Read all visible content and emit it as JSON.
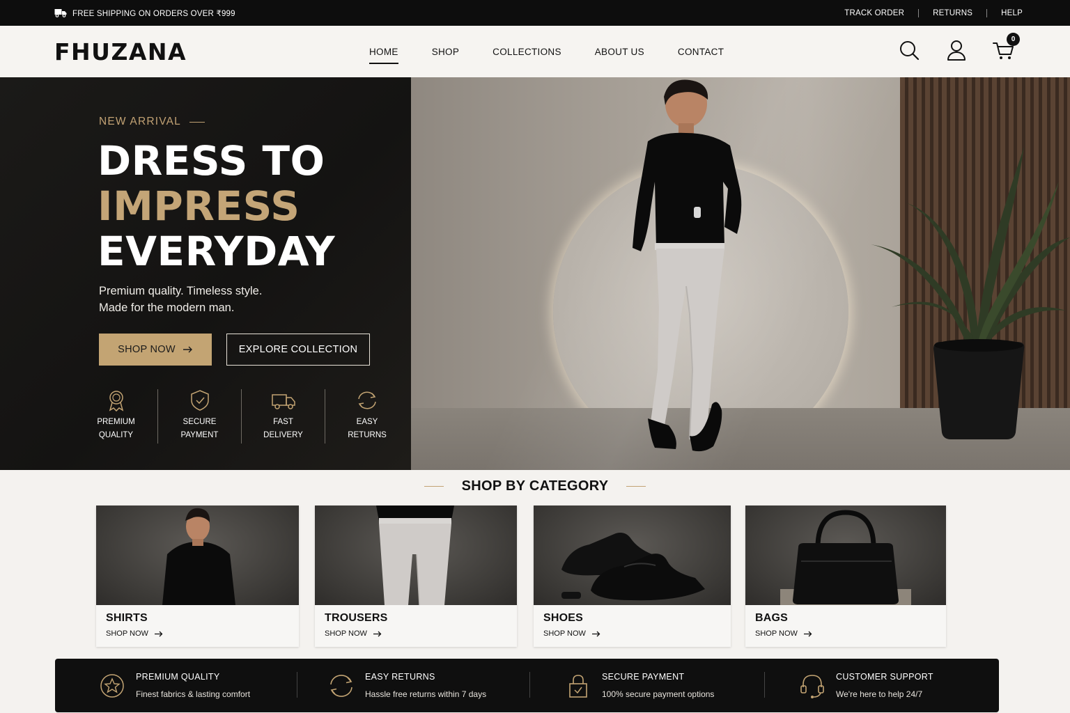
{
  "topbar": {
    "shipping_text": "FREE SHIPPING ON ORDERS OVER ₹999",
    "links": [
      "TRACK ORDER",
      "RETURNS",
      "HELP"
    ]
  },
  "header": {
    "logo": "FHUZANA",
    "nav": [
      "HOME",
      "SHOP",
      "COLLECTIONS",
      "ABOUT US",
      "CONTACT"
    ],
    "active_nav": "HOME",
    "cart_count": "0",
    "icons": [
      "search-icon",
      "user-icon",
      "cart-icon"
    ]
  },
  "hero": {
    "eyebrow": "NEW ARRIVAL",
    "headline_1": "DRESS TO",
    "headline_2": "IMPRESS",
    "headline_3": "EVERYDAY",
    "sub_1": "Premium quality. Timeless style.",
    "sub_2": "Made for the modern man.",
    "primary_button": "SHOP NOW",
    "secondary_button": "EXPLORE COLLECTION",
    "features": [
      {
        "line1": "PREMIUM",
        "line2": "QUALITY",
        "icon": "award-icon"
      },
      {
        "line1": "SECURE",
        "line2": "PAYMENT",
        "icon": "shield-check-icon"
      },
      {
        "line1": "FAST",
        "line2": "DELIVERY",
        "icon": "truck-icon"
      },
      {
        "line1": "EASY",
        "line2": "RETURNS",
        "icon": "refresh-icon"
      }
    ]
  },
  "categories": {
    "heading": "SHOP BY CATEGORY",
    "items": [
      {
        "title": "SHIRTS",
        "cta": "SHOP NOW"
      },
      {
        "title": "TROUSERS",
        "cta": "SHOP NOW"
      },
      {
        "title": "SHOES",
        "cta": "SHOP NOW"
      },
      {
        "title": "BAGS",
        "cta": "SHOP NOW"
      }
    ]
  },
  "benefits": [
    {
      "title": "PREMIUM QUALITY",
      "desc": "Finest fabrics & lasting comfort",
      "icon": "star-badge-icon"
    },
    {
      "title": "EASY RETURNS",
      "desc": "Hassle free returns within 7 days",
      "icon": "refresh-icon"
    },
    {
      "title": "SECURE PAYMENT",
      "desc": "100% secure payment options",
      "icon": "lock-icon"
    },
    {
      "title": "CUSTOMER SUPPORT",
      "desc": "We're here to help 24/7",
      "icon": "headset-icon"
    }
  ],
  "colors": {
    "accent_gold": "#c3a473",
    "dark": "#0d0d0d",
    "background": "#f4f2ef"
  }
}
